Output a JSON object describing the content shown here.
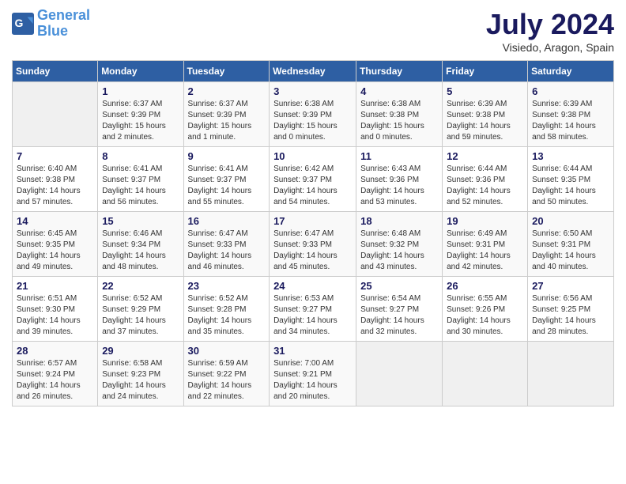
{
  "header": {
    "logo_line1": "General",
    "logo_line2": "Blue",
    "month": "July 2024",
    "location": "Visiedo, Aragon, Spain"
  },
  "days_of_week": [
    "Sunday",
    "Monday",
    "Tuesday",
    "Wednesday",
    "Thursday",
    "Friday",
    "Saturday"
  ],
  "weeks": [
    [
      {
        "day": "",
        "info": ""
      },
      {
        "day": "1",
        "info": "Sunrise: 6:37 AM\nSunset: 9:39 PM\nDaylight: 15 hours\nand 2 minutes."
      },
      {
        "day": "2",
        "info": "Sunrise: 6:37 AM\nSunset: 9:39 PM\nDaylight: 15 hours\nand 1 minute."
      },
      {
        "day": "3",
        "info": "Sunrise: 6:38 AM\nSunset: 9:39 PM\nDaylight: 15 hours\nand 0 minutes."
      },
      {
        "day": "4",
        "info": "Sunrise: 6:38 AM\nSunset: 9:38 PM\nDaylight: 15 hours\nand 0 minutes."
      },
      {
        "day": "5",
        "info": "Sunrise: 6:39 AM\nSunset: 9:38 PM\nDaylight: 14 hours\nand 59 minutes."
      },
      {
        "day": "6",
        "info": "Sunrise: 6:39 AM\nSunset: 9:38 PM\nDaylight: 14 hours\nand 58 minutes."
      }
    ],
    [
      {
        "day": "7",
        "info": "Sunrise: 6:40 AM\nSunset: 9:38 PM\nDaylight: 14 hours\nand 57 minutes."
      },
      {
        "day": "8",
        "info": "Sunrise: 6:41 AM\nSunset: 9:37 PM\nDaylight: 14 hours\nand 56 minutes."
      },
      {
        "day": "9",
        "info": "Sunrise: 6:41 AM\nSunset: 9:37 PM\nDaylight: 14 hours\nand 55 minutes."
      },
      {
        "day": "10",
        "info": "Sunrise: 6:42 AM\nSunset: 9:37 PM\nDaylight: 14 hours\nand 54 minutes."
      },
      {
        "day": "11",
        "info": "Sunrise: 6:43 AM\nSunset: 9:36 PM\nDaylight: 14 hours\nand 53 minutes."
      },
      {
        "day": "12",
        "info": "Sunrise: 6:44 AM\nSunset: 9:36 PM\nDaylight: 14 hours\nand 52 minutes."
      },
      {
        "day": "13",
        "info": "Sunrise: 6:44 AM\nSunset: 9:35 PM\nDaylight: 14 hours\nand 50 minutes."
      }
    ],
    [
      {
        "day": "14",
        "info": "Sunrise: 6:45 AM\nSunset: 9:35 PM\nDaylight: 14 hours\nand 49 minutes."
      },
      {
        "day": "15",
        "info": "Sunrise: 6:46 AM\nSunset: 9:34 PM\nDaylight: 14 hours\nand 48 minutes."
      },
      {
        "day": "16",
        "info": "Sunrise: 6:47 AM\nSunset: 9:33 PM\nDaylight: 14 hours\nand 46 minutes."
      },
      {
        "day": "17",
        "info": "Sunrise: 6:47 AM\nSunset: 9:33 PM\nDaylight: 14 hours\nand 45 minutes."
      },
      {
        "day": "18",
        "info": "Sunrise: 6:48 AM\nSunset: 9:32 PM\nDaylight: 14 hours\nand 43 minutes."
      },
      {
        "day": "19",
        "info": "Sunrise: 6:49 AM\nSunset: 9:31 PM\nDaylight: 14 hours\nand 42 minutes."
      },
      {
        "day": "20",
        "info": "Sunrise: 6:50 AM\nSunset: 9:31 PM\nDaylight: 14 hours\nand 40 minutes."
      }
    ],
    [
      {
        "day": "21",
        "info": "Sunrise: 6:51 AM\nSunset: 9:30 PM\nDaylight: 14 hours\nand 39 minutes."
      },
      {
        "day": "22",
        "info": "Sunrise: 6:52 AM\nSunset: 9:29 PM\nDaylight: 14 hours\nand 37 minutes."
      },
      {
        "day": "23",
        "info": "Sunrise: 6:52 AM\nSunset: 9:28 PM\nDaylight: 14 hours\nand 35 minutes."
      },
      {
        "day": "24",
        "info": "Sunrise: 6:53 AM\nSunset: 9:27 PM\nDaylight: 14 hours\nand 34 minutes."
      },
      {
        "day": "25",
        "info": "Sunrise: 6:54 AM\nSunset: 9:27 PM\nDaylight: 14 hours\nand 32 minutes."
      },
      {
        "day": "26",
        "info": "Sunrise: 6:55 AM\nSunset: 9:26 PM\nDaylight: 14 hours\nand 30 minutes."
      },
      {
        "day": "27",
        "info": "Sunrise: 6:56 AM\nSunset: 9:25 PM\nDaylight: 14 hours\nand 28 minutes."
      }
    ],
    [
      {
        "day": "28",
        "info": "Sunrise: 6:57 AM\nSunset: 9:24 PM\nDaylight: 14 hours\nand 26 minutes."
      },
      {
        "day": "29",
        "info": "Sunrise: 6:58 AM\nSunset: 9:23 PM\nDaylight: 14 hours\nand 24 minutes."
      },
      {
        "day": "30",
        "info": "Sunrise: 6:59 AM\nSunset: 9:22 PM\nDaylight: 14 hours\nand 22 minutes."
      },
      {
        "day": "31",
        "info": "Sunrise: 7:00 AM\nSunset: 9:21 PM\nDaylight: 14 hours\nand 20 minutes."
      },
      {
        "day": "",
        "info": ""
      },
      {
        "day": "",
        "info": ""
      },
      {
        "day": "",
        "info": ""
      }
    ]
  ]
}
